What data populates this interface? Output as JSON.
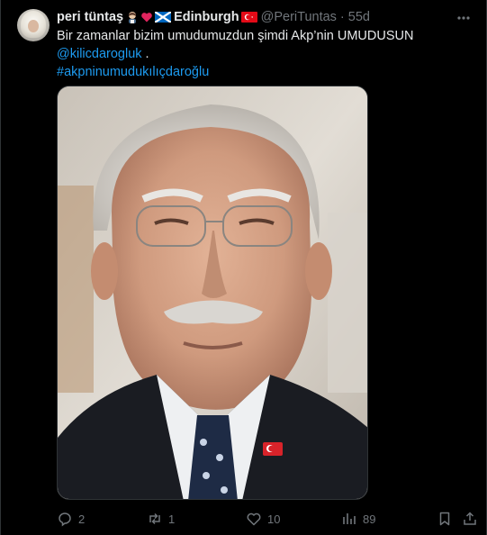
{
  "tweet": {
    "author_name": "peri tüntaş",
    "author_name_suffix": "Edinburgh",
    "handle": "@PeriTuntas",
    "separator": "·",
    "time": "55d",
    "text_line1": "Bir zamanlar bizim umudumuzdun şimdi Akp’nin UMUDUSUN",
    "mention": "@kilicdarogluk",
    "mention_suffix": " .",
    "hashtag": "#akpninumudukılıçdaroğlu",
    "colors": {
      "link": "#1d9bf0",
      "muted": "#71767b",
      "text": "#e7e9ea",
      "background": "#000000"
    }
  },
  "actions": {
    "replies": "2",
    "reposts": "1",
    "likes": "10",
    "views": "89",
    "icons": [
      "reply-icon",
      "repost-icon",
      "like-icon",
      "views-icon",
      "bookmark-icon",
      "share-icon"
    ]
  }
}
